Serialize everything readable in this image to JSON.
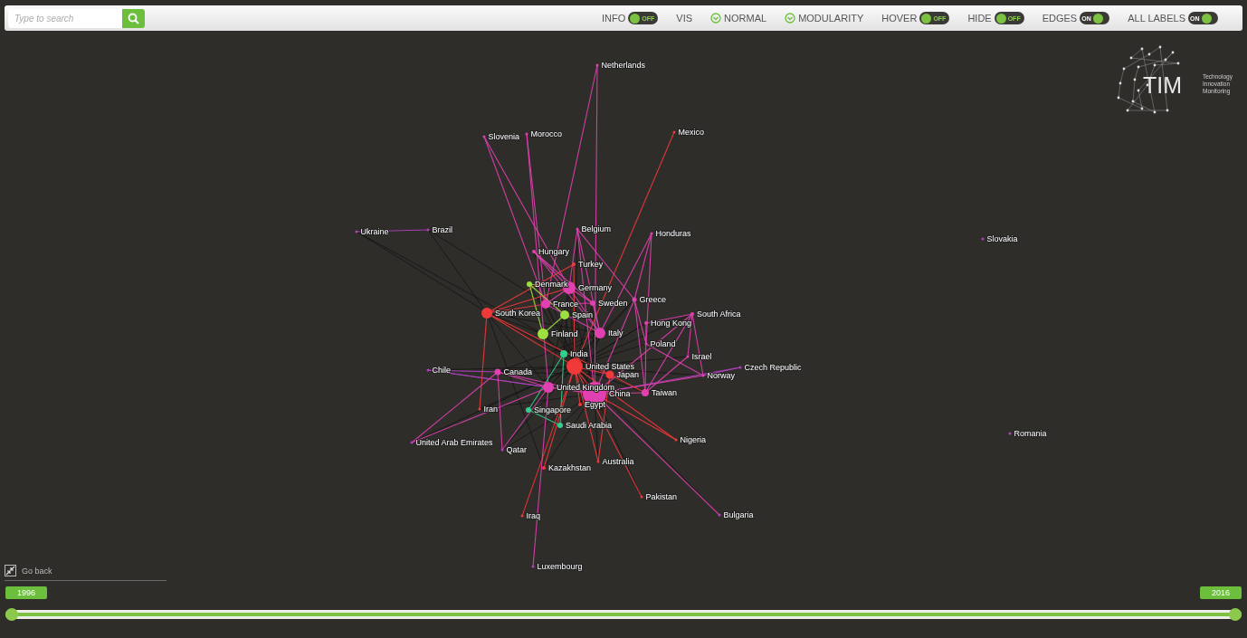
{
  "search": {
    "placeholder": "Type to search"
  },
  "toolbar": [
    {
      "kind": "toggle",
      "label": "INFO",
      "on": false,
      "state_text": "OFF"
    },
    {
      "kind": "label",
      "label": "VIS"
    },
    {
      "kind": "option",
      "label": "NORMAL",
      "checked": true
    },
    {
      "kind": "option",
      "label": "MODULARITY",
      "checked": true
    },
    {
      "kind": "toggle",
      "label": "HOVER",
      "on": false,
      "state_text": "OFF"
    },
    {
      "kind": "toggle",
      "label": "HIDE",
      "on": false,
      "state_text": "OFF"
    },
    {
      "kind": "toggle",
      "label": "EDGES",
      "on": true,
      "state_text": "ON"
    },
    {
      "kind": "toggle",
      "label": "ALL LABELS",
      "on": true,
      "state_text": "ON"
    }
  ],
  "logo": {
    "wordmark": "TIM",
    "tagline": [
      "Technology",
      "Innovation",
      "Monitoring"
    ]
  },
  "nodes": [
    {
      "label": "Netherlands",
      "color": "#e040b0"
    },
    {
      "label": "Slovenia",
      "color": "#e040b0"
    },
    {
      "label": "Morocco",
      "color": "#e040b0"
    },
    {
      "label": "Mexico",
      "color": "#f03a3a"
    },
    {
      "label": "Ukraine",
      "color": "#b040c0"
    },
    {
      "label": "Brazil",
      "color": "#b040c0"
    },
    {
      "label": "Belgium",
      "color": "#e040b0"
    },
    {
      "label": "Honduras",
      "color": "#e040b0"
    },
    {
      "label": "Slovakia",
      "color": "#b040c0"
    },
    {
      "label": "Hungary",
      "color": "#e040b0"
    },
    {
      "label": "Turkey",
      "color": "#f03a3a"
    },
    {
      "label": "Denmark",
      "color": "#9ee040"
    },
    {
      "label": "Germany",
      "color": "#e040b0"
    },
    {
      "label": "France",
      "color": "#e040b0"
    },
    {
      "label": "Sweden",
      "color": "#e040b0"
    },
    {
      "label": "Greece",
      "color": "#e040b0"
    },
    {
      "label": "South Korea",
      "color": "#f03a3a"
    },
    {
      "label": "Spain",
      "color": "#9ee040"
    },
    {
      "label": "South Africa",
      "color": "#e040b0"
    },
    {
      "label": "Hong Kong",
      "color": "#e040b0"
    },
    {
      "label": "Finland",
      "color": "#9ee040"
    },
    {
      "label": "Italy",
      "color": "#e040b0"
    },
    {
      "label": "Poland",
      "color": "#e040b0"
    },
    {
      "label": "India",
      "color": "#30d090"
    },
    {
      "label": "Israel",
      "color": "#e040b0"
    },
    {
      "label": "United States",
      "color": "#f03a3a"
    },
    {
      "label": "Chile",
      "color": "#b040c0"
    },
    {
      "label": "Canada",
      "color": "#e040b0"
    },
    {
      "label": "Japan",
      "color": "#f03a3a"
    },
    {
      "label": "Czech Republic",
      "color": "#b040c0"
    },
    {
      "label": "Norway",
      "color": "#e040b0"
    },
    {
      "label": "United Kingdom",
      "color": "#e040b0"
    },
    {
      "label": "China",
      "color": "#e040b0"
    },
    {
      "label": "Taiwan",
      "color": "#e040b0"
    },
    {
      "label": "Egypt",
      "color": "#f03a3a"
    },
    {
      "label": "Iran",
      "color": "#f03a3a"
    },
    {
      "label": "Singapore",
      "color": "#30d090"
    },
    {
      "label": "Saudi Arabia",
      "color": "#30d090"
    },
    {
      "label": "United Arab Emirates",
      "color": "#b040c0"
    },
    {
      "label": "Nigeria",
      "color": "#f03a3a"
    },
    {
      "label": "Qatar",
      "color": "#b040c0"
    },
    {
      "label": "Romania",
      "color": "#b040c0"
    },
    {
      "label": "Kazakhstan",
      "color": "#f03a3a"
    },
    {
      "label": "Australia",
      "color": "#f03a3a"
    },
    {
      "label": "Pakistan",
      "color": "#f03a3a"
    },
    {
      "label": "Bulgaria",
      "color": "#b040c0"
    },
    {
      "label": "Iraq",
      "color": "#f03a3a"
    },
    {
      "label": "Luxembourg",
      "color": "#b040c0"
    }
  ],
  "go_back": {
    "label": "Go back"
  },
  "timeline": {
    "handles": [
      {
        "label": "1996",
        "level": 0
      },
      {
        "label": "2016",
        "level": 1
      }
    ]
  }
}
